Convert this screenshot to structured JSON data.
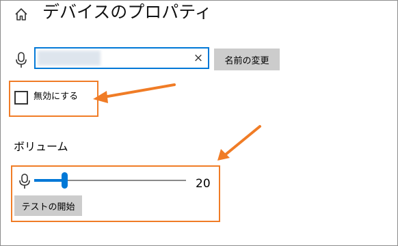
{
  "header": {
    "title": "デバイスのプロパティ",
    "home_icon": "home-icon"
  },
  "name": {
    "value": "",
    "clear_glyph": "×",
    "rename_label": "名前の変更",
    "mic_icon": "microphone-icon"
  },
  "disable": {
    "label": "無効にする",
    "checked": false
  },
  "volume": {
    "section_title": "ボリューム",
    "level": 20,
    "value_text": "20",
    "mic_icon": "microphone-icon",
    "test_label": "テストの開始"
  },
  "colors": {
    "accent": "#0078d7",
    "highlight": "#f07c26",
    "button_bg": "#cccccc"
  }
}
